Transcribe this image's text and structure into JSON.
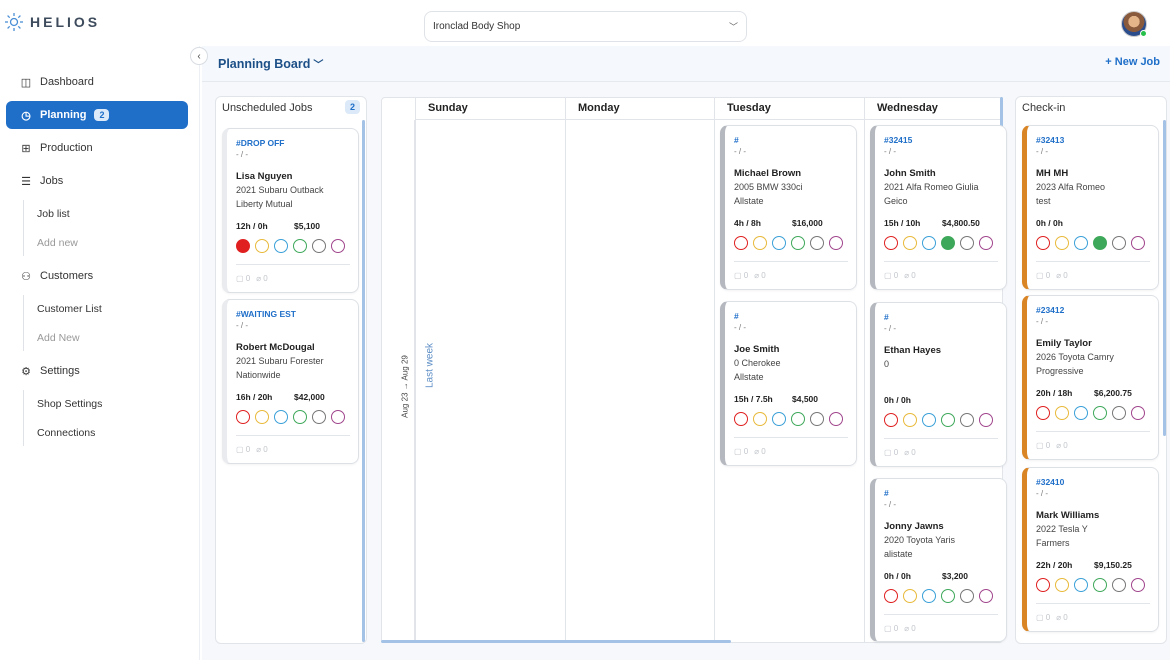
{
  "app": {
    "logo": "HELIOS"
  },
  "shop_select": {
    "value": "Ironclad Body Shop"
  },
  "sidebar": {
    "items": [
      {
        "label": "Dashboard",
        "icon": "dashboard-icon"
      },
      {
        "label": "Planning",
        "icon": "clock-icon",
        "badge": "2"
      },
      {
        "label": "Production",
        "icon": "grid-icon"
      },
      {
        "label": "Jobs",
        "icon": "stack-icon"
      },
      {
        "label": "Customers",
        "icon": "users-icon"
      },
      {
        "label": "Settings",
        "icon": "gear-icon"
      }
    ],
    "jobs_sub": [
      "Job list",
      "Add new"
    ],
    "customers_sub": [
      "Customer List",
      "Add New"
    ],
    "settings_sub": [
      "Shop Settings",
      "Connections"
    ]
  },
  "header": {
    "title": "Planning Board",
    "new_job": "New Job"
  },
  "board": {
    "unscheduled_title": "Unscheduled Jobs",
    "unscheduled_count": "2",
    "checkin_title": "Check-in",
    "week_label": "Last week",
    "week_range": "Aug 23 → Aug 29",
    "days": [
      "Sunday",
      "Monday",
      "Tuesday",
      "Wednesday"
    ]
  },
  "status_colors": [
    "#e02020",
    "#e8b93a",
    "#3aa0d8",
    "#3ea85a",
    "#777777",
    "#a0458c"
  ],
  "cards": {
    "unscheduled": [
      {
        "num": "#DROP OFF",
        "dash": "- / -",
        "name": "Lisa Nguyen",
        "car": "2021 Subaru Outback",
        "ins": "Liberty Mutual",
        "hours": "12h / 0h",
        "price": "$5,100",
        "filled": 0,
        "meta_comments": "0",
        "meta_files": "0"
      },
      {
        "num": "#WAITING EST",
        "dash": "- / -",
        "name": "Robert McDougal",
        "car": "2021 Subaru Forester",
        "ins": "Nationwide",
        "hours": "16h / 20h",
        "price": "$42,000",
        "filled": -1,
        "meta_comments": "0",
        "meta_files": "0"
      }
    ],
    "tuesday": [
      {
        "num": "#",
        "dash": "- / -",
        "name": "Michael Brown",
        "car": "2005 BMW 330ci",
        "ins": "Allstate",
        "hours": "4h / 8h",
        "price": "$16,000",
        "filled": -1,
        "meta_comments": "0",
        "meta_files": "0"
      },
      {
        "num": "#",
        "dash": "- / -",
        "name": "Joe Smith",
        "car": "0 Cherokee",
        "ins": "Allstate",
        "hours": "15h / 7.5h",
        "price": "$4,500",
        "filled": -1,
        "meta_comments": "0",
        "meta_files": "0"
      }
    ],
    "wednesday": [
      {
        "num": "#32415",
        "dash": "- / -",
        "name": "John Smith",
        "car": "2021 Alfa Romeo Giulia",
        "ins": "Geico",
        "hours": "15h / 10h",
        "price": "$4,800.50",
        "filled": 3,
        "meta_comments": "0",
        "meta_files": "0"
      },
      {
        "num": "#",
        "dash": "- / -",
        "name": "Ethan Hayes",
        "car": "0",
        "ins": "",
        "hours": "0h / 0h",
        "price": "",
        "filled": -1,
        "meta_comments": "0",
        "meta_files": "0"
      },
      {
        "num": "#",
        "dash": "- / -",
        "name": "Jonny Jawns",
        "car": "2020 Toyota Yaris",
        "ins": "alistate",
        "hours": "0h / 0h",
        "price": "$3,200",
        "filled": -1,
        "meta_comments": "0",
        "meta_files": "0"
      }
    ],
    "checkin": [
      {
        "num": "#32413",
        "dash": "- / -",
        "name": "MH MH",
        "car": "2023 Alfa Romeo",
        "ins": "test",
        "hours": "0h / 0h",
        "price": "",
        "filled": 3,
        "meta_comments": "0",
        "meta_files": "0"
      },
      {
        "num": "#23412",
        "dash": "- / -",
        "name": "Emily Taylor",
        "car": "2026 Toyota Camry",
        "ins": "Progressive",
        "hours": "20h / 18h",
        "price": "$6,200.75",
        "filled": -1,
        "meta_comments": "0",
        "meta_files": "0"
      },
      {
        "num": "#32410",
        "dash": "- / -",
        "name": "Mark Williams",
        "car": "2022 Tesla Y",
        "ins": "Farmers",
        "hours": "22h / 20h",
        "price": "$9,150.25",
        "filled": -1,
        "meta_comments": "0",
        "meta_files": "0"
      }
    ]
  }
}
